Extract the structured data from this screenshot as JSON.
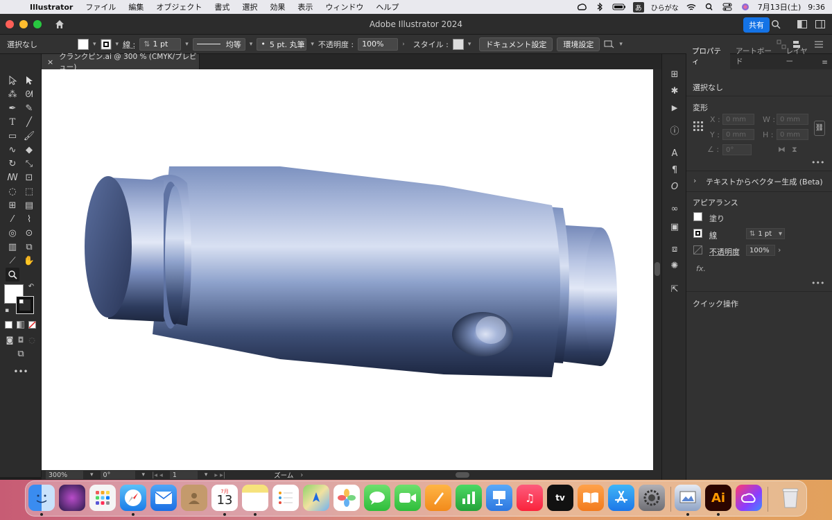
{
  "menubar": {
    "app": "Illustrator",
    "items": [
      "ファイル",
      "編集",
      "オブジェクト",
      "書式",
      "選択",
      "効果",
      "表示",
      "ウィンドウ",
      "ヘルプ"
    ],
    "ime": "あ",
    "ime_label": "ひらがな",
    "date": "7月13日(土)",
    "time": "9:36"
  },
  "titlebar": {
    "title": "Adobe Illustrator 2024",
    "share": "共有"
  },
  "controlbar": {
    "selection": "選択なし",
    "stroke_label": "線 :",
    "stroke_weight": "1 pt",
    "stroke_style": "均等",
    "brush": "5 pt. 丸筆",
    "opacity_label": "不透明度 :",
    "opacity": "100%",
    "style_label": "スタイル :",
    "doc_settings": "ドキュメント設定",
    "preferences": "環境設定"
  },
  "document": {
    "tab": "クランクピン.ai @ 300 % (CMYK/プレビュー)"
  },
  "statusbar": {
    "zoom": "300%",
    "rotation": "0°",
    "artboard": "1",
    "tool": "ズーム"
  },
  "properties": {
    "tabs": [
      "プロパティ",
      "アートボード",
      "レイヤー"
    ],
    "selection": "選択なし",
    "transform": "変形",
    "x_label": "X :",
    "y_label": "Y :",
    "w_label": "W :",
    "h_label": "H :",
    "x_value": "0 mm",
    "y_value": "0 mm",
    "w_value": "0 mm",
    "h_value": "0 mm",
    "angle_value": "0°",
    "text_to_vector": "テキストからベクター生成 (Beta)",
    "appearance": "アピアランス",
    "fill": "塗り",
    "stroke": "線",
    "stroke_weight": "1 pt",
    "opacity_label": "不透明度",
    "opacity": "100%",
    "fx": "fx.",
    "quick_actions": "クイック操作"
  },
  "dock": {
    "calendar_month": "7月",
    "calendar_day": "13",
    "illustrator": "Ai",
    "appletv": "tv"
  },
  "colors": {
    "accent": "#1473e6",
    "cylinder_light": "#c9d3ea",
    "cylinder_mid": "#6a82b4",
    "cylinder_dark": "#1e2a44"
  }
}
